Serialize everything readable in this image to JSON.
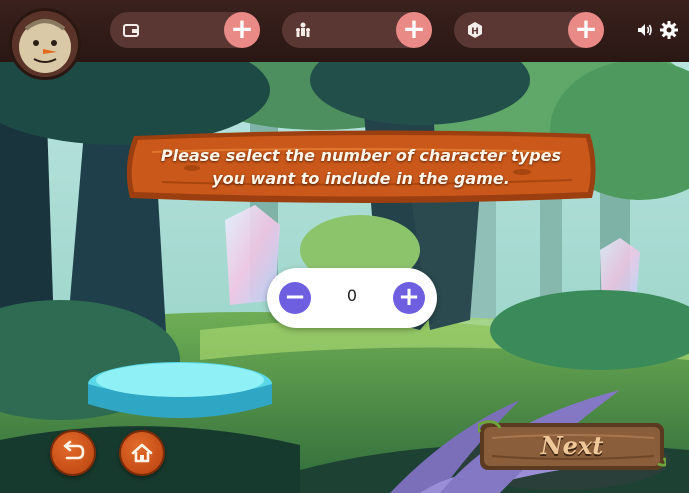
{
  "prompt": {
    "line1": "Please select the number of character types",
    "line2": "you want to include in the game."
  },
  "stepper": {
    "value": "0",
    "minus": "−",
    "plus": "+"
  },
  "resources": [
    {
      "icon": "wallet-icon",
      "plus": "+"
    },
    {
      "icon": "team-icon",
      "plus": "+"
    },
    {
      "icon": "hint-icon",
      "glyph": "H",
      "plus": "+"
    }
  ],
  "next_label": "Next",
  "colors": {
    "topbar": "#2f1a16",
    "resource_pill": "#5a3732",
    "plus_button": "#e98a86",
    "stepper_button": "#6d5fe0",
    "round_button": "#d4571e",
    "sign_wood": "#c5561a"
  }
}
